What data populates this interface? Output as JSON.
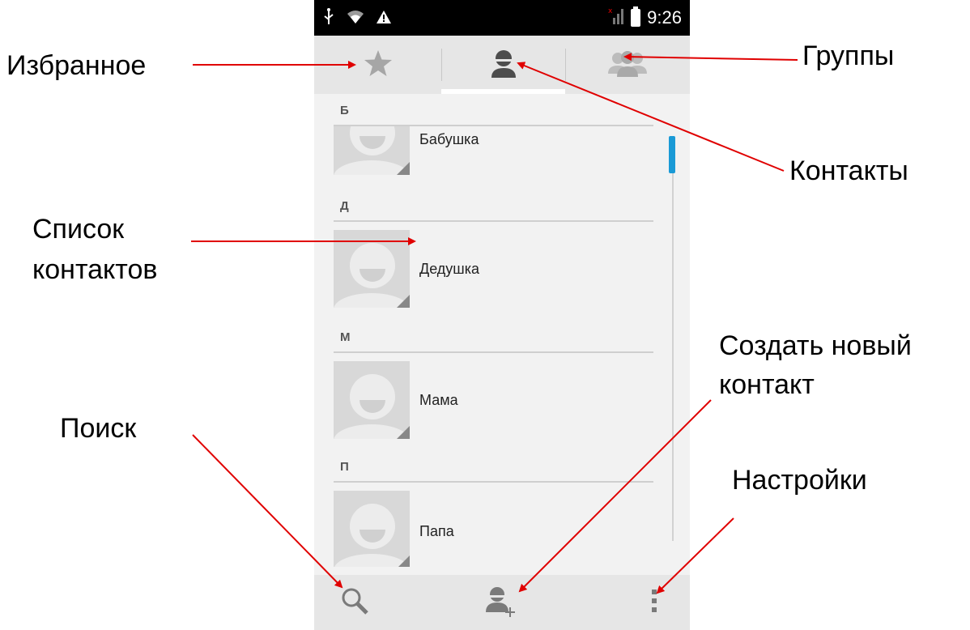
{
  "status_bar": {
    "time": "9:26"
  },
  "tabs": {
    "favorites": "favorites-tab",
    "contacts": "contacts-tab",
    "groups": "groups-tab"
  },
  "contacts": {
    "sections": [
      {
        "letter": "Б",
        "names": [
          "Бабушка"
        ]
      },
      {
        "letter": "Д",
        "names": [
          "Дедушка"
        ]
      },
      {
        "letter": "М",
        "names": [
          "Мама"
        ]
      },
      {
        "letter": "П",
        "names": [
          "Папа"
        ]
      }
    ]
  },
  "annotations": {
    "favorites": "Избранное",
    "groups": "Группы",
    "contacts": "Контакты",
    "contact_list_line1": "Список",
    "contact_list_line2": "контактов",
    "create_line1": "Создать новый",
    "create_line2": "контакт",
    "search": "Поиск",
    "settings": "Настройки"
  },
  "colors": {
    "accent": "#1a9ad6",
    "arrow": "#e00000",
    "background": "#f2f2f2",
    "bar": "#e6e6e6"
  }
}
